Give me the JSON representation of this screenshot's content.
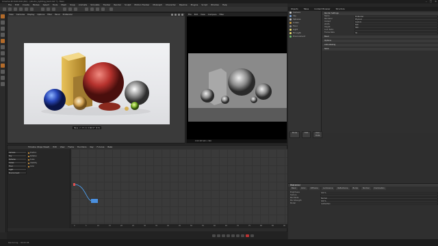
{
  "app": {
    "title": "Cinema 4D R20.026 (RC) - [studio_lighting_test.c4d *] - Main",
    "window_controls": [
      "–",
      "□",
      "×"
    ]
  },
  "menubar": [
    "File",
    "Edit",
    "Create",
    "Modes",
    "Select",
    "Tools",
    "Mesh",
    "Snap",
    "Animate",
    "Simulate",
    "Tracker",
    "Render",
    "Sculpt",
    "Motion Tracker",
    "MoGraph",
    "Character",
    "Pipeline",
    "Plugins",
    "Script",
    "Window",
    "Help"
  ],
  "viewport": {
    "menu": [
      "View",
      "Cameras",
      "Display",
      "Options",
      "Filter",
      "Panel",
      "ProRender"
    ],
    "caption": "Pass: 2 / 8 (1) 0:00:07 [3.5]"
  },
  "render_view": {
    "menu": [
      "File",
      "Edit",
      "View",
      "Compare",
      "Filter"
    ],
    "status": "0:00:08  640 x 360"
  },
  "object_manager": {
    "tabs": [
      "Objects",
      "Takes",
      "Content Browser",
      "Structure"
    ],
    "objects": [
      {
        "name": "Camera",
        "color": "#cfcfcf"
      },
      {
        "name": "Sky",
        "color": "#7aa8e0"
      },
      {
        "name": "Spheres",
        "color": "#c0c0c0"
      },
      {
        "name": "Cubes",
        "color": "#d0a040"
      },
      {
        "name": "Floor",
        "color": "#909090"
      },
      {
        "name": "Light",
        "color": "#f0e070"
      },
      {
        "name": "Fill Light",
        "color": "#f0e070"
      },
      {
        "name": "Environment",
        "color": "#70c070"
      }
    ],
    "buttons": [
      "Mode",
      "Edit",
      "User Data"
    ]
  },
  "attributes": {
    "title": "Render Settings",
    "rows": [
      {
        "k": "Name",
        "v": "ProRender"
      },
      {
        "k": "Renderer",
        "v": "Physical"
      },
      {
        "k": "Output",
        "v": "Custom"
      },
      {
        "k": "Width",
        "v": "640"
      },
      {
        "k": "Height",
        "v": "360"
      },
      {
        "k": "Lock Ratio",
        "v": ""
      },
      {
        "k": "Frame Rate",
        "v": "30"
      }
    ],
    "sections": [
      "Basic",
      "Options",
      "Anti-Aliasing",
      "Save"
    ]
  },
  "timeline": {
    "title": "Timeline (Dope Sheet)",
    "menu": [
      "Edit",
      "View",
      "Frame",
      "Functions",
      "Key",
      "F-Curve",
      "Bake"
    ],
    "tree": [
      "Camera",
      "Sky",
      "Spheres",
      "Cubes",
      "Floor",
      "Light",
      "Environment"
    ],
    "tracks": [
      "Position",
      "Rotation",
      "Scale",
      "Visibility",
      "Color"
    ],
    "ruler_ticks": [
      "0",
      "5",
      "10",
      "15",
      "20",
      "25",
      "30",
      "35",
      "40",
      "45",
      "50",
      "55",
      "60",
      "65",
      "70",
      "75",
      "80",
      "85",
      "90"
    ]
  },
  "material": {
    "title": "Material",
    "tabs": [
      "Basic",
      "Color",
      "Diffusion",
      "Luminance",
      "Reflectance",
      "Bump",
      "Normal",
      "Illumination"
    ],
    "rows": [
      {
        "k": "Brightness",
        "v": "100 %"
      },
      {
        "k": "Texture",
        "v": ""
      },
      {
        "k": "Mix Mode",
        "v": "Normal"
      },
      {
        "k": "Mix Strength",
        "v": "100 %"
      },
      {
        "k": "Model",
        "v": "Lambertian"
      }
    ]
  },
  "statusbar": {
    "text": "Rendering... 00:00:08"
  }
}
